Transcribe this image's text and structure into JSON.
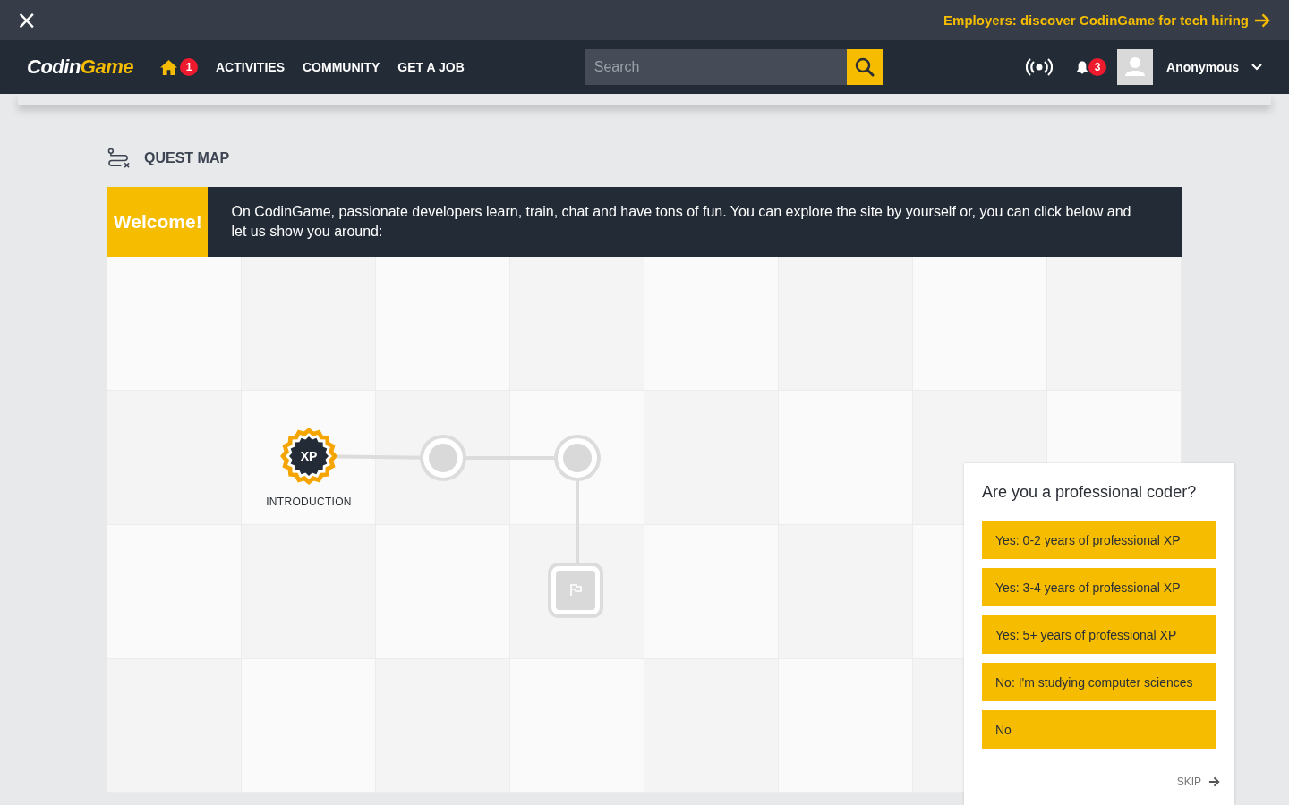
{
  "banner": {
    "close": "×",
    "link": "Employers: discover CodinGame for tech hiring"
  },
  "navbar": {
    "logo": {
      "first": "Codin",
      "second": "Game"
    },
    "home_badge": "1",
    "links": [
      "ACTIVITIES",
      "COMMUNITY",
      "GET A JOB"
    ],
    "search": {
      "placeholder": "Search"
    },
    "notifications_badge": "3",
    "user": "Anonymous"
  },
  "page": {
    "title": "QUEST MAP"
  },
  "welcome": {
    "label": "Welcome!",
    "text": "On CodinGame, passionate developers learn, train, chat and have tons of fun. You can explore the site by yourself or, you can click below and let us show you around:"
  },
  "map": {
    "nodes": [
      {
        "kind": "badge",
        "badge": "XP",
        "label": "INTRODUCTION"
      },
      {
        "kind": "circle"
      },
      {
        "kind": "circle"
      },
      {
        "kind": "flag"
      }
    ]
  },
  "survey": {
    "question": "Are you a professional coder?",
    "options": [
      "Yes: 0-2 years of professional XP",
      "Yes: 3-4 years of professional XP",
      "Yes: 5+ years of professional XP",
      "No: I'm studying computer sciences",
      "No"
    ],
    "skip": "SKIP"
  }
}
